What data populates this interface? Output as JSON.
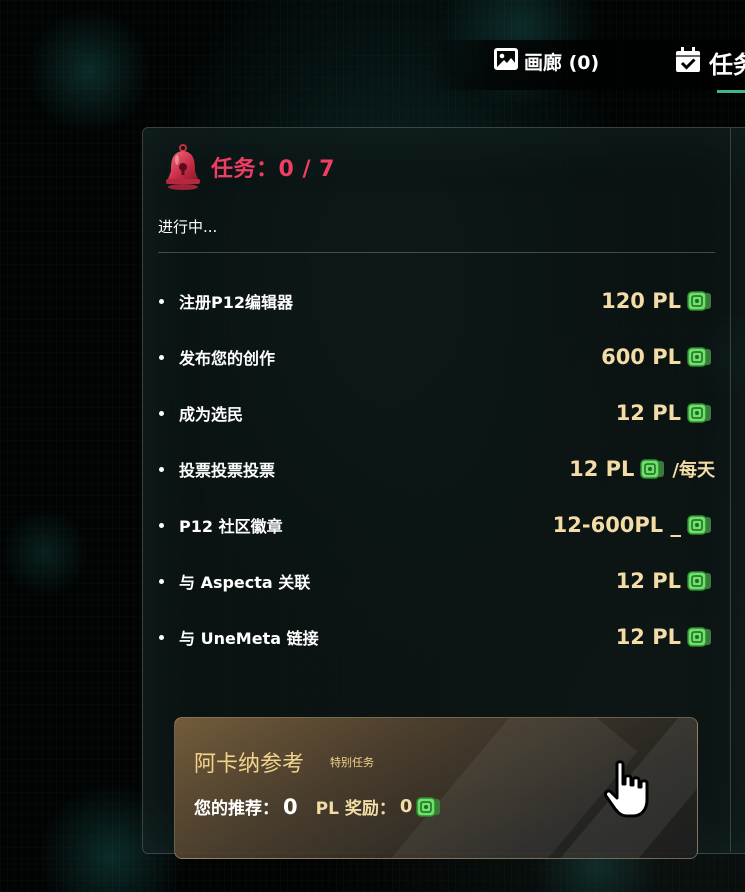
{
  "nav": {
    "gallery_label": "画廊 (0)",
    "tasks_label": "任务",
    "gallery_icon": "image-icon",
    "tasks_icon": "calendar-check-icon"
  },
  "panel": {
    "title": "任务：0 / 7",
    "status": "进行中...",
    "icon": "bell-icon"
  },
  "tasks": [
    {
      "label": "注册P12编辑器",
      "reward": "120 PL",
      "suffix": ""
    },
    {
      "label": "发布您的创作",
      "reward": "600 PL",
      "suffix": ""
    },
    {
      "label": "成为选民",
      "reward": "12 PL",
      "suffix": ""
    },
    {
      "label": "投票投票投票",
      "reward": "12 PL",
      "suffix": "/每天"
    },
    {
      "label": "P12 社区徽章",
      "reward": "12-600PL _",
      "suffix": ""
    },
    {
      "label": "与 Aspecta 关联",
      "reward": "12 PL",
      "suffix": ""
    },
    {
      "label": "与 UneMeta 链接",
      "reward": "12 PL",
      "suffix": ""
    }
  ],
  "referral": {
    "title": "阿卡纳参考",
    "badge": "特别任务",
    "referrals_label": "您的推荐：",
    "referrals_value": "0",
    "pl_label": "PL 奖励：",
    "pl_value": "0",
    "cursor_icon": "hand-pointer-icon"
  },
  "colors": {
    "accent_red": "#f03d63",
    "reward_gold": "#f3dca6",
    "tab_underline": "#3fb68b",
    "card_title": "#f2d48c"
  }
}
